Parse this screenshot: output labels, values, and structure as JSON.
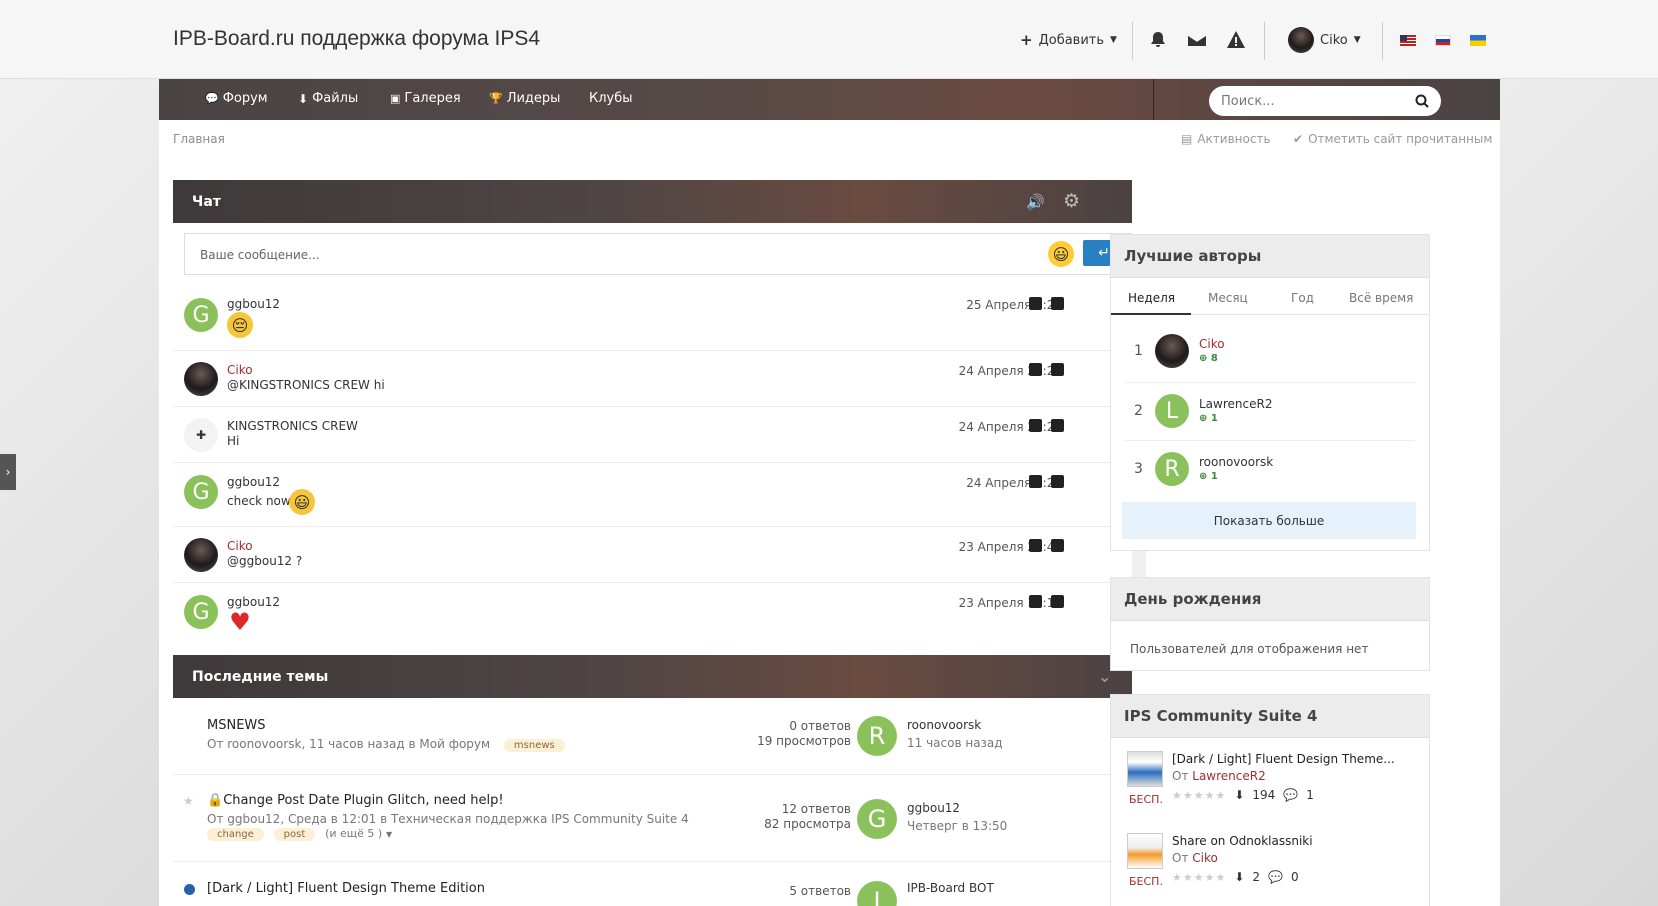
{
  "header": {
    "site_title": "IPB-Board.ru поддержка форума IPS4",
    "add_label": "Добавить",
    "username": "Ciko"
  },
  "nav": {
    "items": [
      "Форум",
      "Файлы",
      "Галерея",
      "Лидеры",
      "Клубы"
    ],
    "search_placeholder": "Поиск..."
  },
  "breadcrumb": "Главная",
  "toplinks": {
    "activity": "Активность",
    "mark_read": "Отметить сайт прочитанным"
  },
  "chat": {
    "title": "Чат",
    "input_placeholder": "Ваше сообщение...",
    "messages": [
      {
        "user": "ggbou12",
        "text": "",
        "date": "25 Апреля 5:23"
      },
      {
        "user": "Ciko",
        "text": "@KINGSTRONICS CREW hi",
        "date": "24 Апреля 22:26"
      },
      {
        "user": "KINGSTRONICS CREW",
        "text": "Hi",
        "date": "24 Апреля 21:25"
      },
      {
        "user": "ggbou12",
        "text": "check now",
        "date": "24 Апреля 2:22"
      },
      {
        "user": "Ciko",
        "text": "@ggbou12 ?",
        "date": "23 Апреля 23:44"
      },
      {
        "user": "ggbou12",
        "text": "",
        "date": "23 Апреля 14:10"
      }
    ]
  },
  "topics": {
    "title": "Последние темы",
    "rows": [
      {
        "title": "MSNEWS",
        "meta": "От roonovoorsk, 11 часов назад в Мой форум",
        "tags": [
          "msnews"
        ],
        "replies": "0 ответов",
        "views": "19 просмотров",
        "last_user": "roonovoorsk",
        "last_time": "11 часов назад",
        "last_initial": "R"
      },
      {
        "title": "Change Post Date Plugin Glitch, need help!",
        "meta": "От ggbou12, Среда в 12:01 в Техническая поддержка IPS Community Suite 4",
        "tags": [
          "change",
          "post"
        ],
        "more_tags": "(и ещё 5 )",
        "replies": "12 ответов",
        "views": "82 просмотра",
        "last_user": "ggbou12",
        "last_time": "Четверг в 13:50",
        "last_initial": "G"
      },
      {
        "title": "[Dark / Light] Fluent Design Theme Edition",
        "replies": "5 ответов",
        "last_user": "IPB-Board BOT",
        "last_initial": "I"
      }
    ]
  },
  "top_authors": {
    "title": "Лучшие авторы",
    "tabs": [
      "Неделя",
      "Месяц",
      "Год",
      "Всё время"
    ],
    "leaders": [
      {
        "rank": "1",
        "name": "Ciko",
        "score": "8"
      },
      {
        "rank": "2",
        "name": "LawrenceR2",
        "score": "1",
        "initial": "L"
      },
      {
        "rank": "3",
        "name": "roonovoorsk",
        "score": "1",
        "initial": "R"
      }
    ],
    "show_more": "Показать больше"
  },
  "birthday": {
    "title": "День рождения",
    "empty": "Пользователей для отображения нет"
  },
  "ips": {
    "title": "IPS Community Suite 4",
    "files": [
      {
        "title": "[Dark / Light] Fluent Design Theme...",
        "author_prefix": "От",
        "author": "LawrenceR2",
        "badge": "БЕСП.",
        "downloads": "194",
        "comments": "1"
      },
      {
        "title": "Share on Odnoklassniki",
        "author_prefix": "От",
        "author": "Ciko",
        "badge": "БЕСП.",
        "downloads": "2",
        "comments": "0"
      }
    ]
  },
  "colors": {
    "accent_blue": "#2680c2",
    "user_red": "#a62d2d",
    "avatar_green": "#8bc15a"
  }
}
